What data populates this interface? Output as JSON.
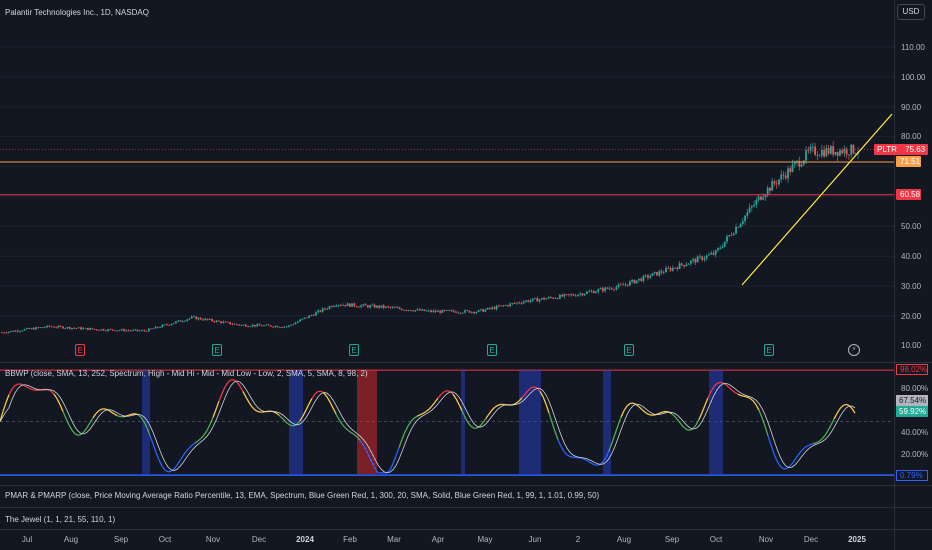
{
  "header": {
    "symbol_title": "Palantir Technologies Inc., 1D, NASDAQ",
    "currency_button": "USD"
  },
  "price_axis": {
    "labels": [
      "110.00",
      "100.00",
      "90.00",
      "80.00",
      "50.00",
      "40.00",
      "30.00",
      "20.00",
      "10.00"
    ],
    "current_price_tag": {
      "symbol": "PLTR",
      "value": "75.63",
      "color": "#f23645"
    },
    "hline_tags": [
      {
        "value": "71.51",
        "color": "#f7a04b"
      },
      {
        "value": "60.58",
        "color": "#f23645"
      }
    ]
  },
  "price_lines": {
    "orange_level": 71.51,
    "red_level": 60.58,
    "current_price": 75.63
  },
  "events": [
    {
      "icon": "earnings-icon",
      "label": "E",
      "color": "#f23645"
    },
    {
      "icon": "earnings-icon",
      "label": "E",
      "color": "#22ab94"
    },
    {
      "icon": "earnings-icon",
      "label": "E",
      "color": "#22ab94"
    },
    {
      "icon": "earnings-icon",
      "label": "E",
      "color": "#22ab94"
    },
    {
      "icon": "earnings-icon",
      "label": "E",
      "color": "#22ab94"
    },
    {
      "icon": "earnings-icon",
      "label": "E",
      "color": "#22ab94"
    },
    {
      "icon": "flash-icon",
      "label": "⚡",
      "color": "#b2b5be"
    }
  ],
  "indicators": {
    "bbwp": {
      "legend": "BBWP (close, SMA, 13, 252, Spectrum, High - Mid Hi - Mid - Mid Low - Low, 2, SMA, 5, SMA, 8, 98, 2)",
      "axis_labels": [
        "80.00%",
        "40.00%",
        "20.00%"
      ],
      "tags": [
        {
          "value": "98.02%",
          "bg": "#131722",
          "fg": "#f23645",
          "border": "#f23645"
        },
        {
          "value": "67.54%",
          "bg": "#b2b5be",
          "fg": "#131722",
          "border": "#b2b5be"
        },
        {
          "value": "59.92%",
          "bg": "#22ab94",
          "fg": "#ffffff",
          "border": "#22ab94"
        },
        {
          "value": "0.79%",
          "bg": "#131722",
          "fg": "#2962ff",
          "border": "#2962ff"
        }
      ]
    },
    "pmarp": {
      "legend": "PMAR & PMARP (close, Price Moving Average Ratio Percentile, 13, EMA, Spectrum, Blue Green Red, 1, 300, 20, SMA, Solid, Blue Green Red, 1, 99, 1, 1.01, 0.99, 50)"
    },
    "jewel": {
      "legend": "The Jewel (1, 1, 21, 55, 110, 1)"
    }
  },
  "time_axis": {
    "labels": [
      "Jul",
      "Aug",
      "Sep",
      "Oct",
      "Nov",
      "Dec",
      "2024",
      "Feb",
      "Mar",
      "Apr",
      "May",
      "Jun",
      "2",
      "Aug",
      "Sep",
      "Oct",
      "Nov",
      "Dec",
      "2025"
    ],
    "bold_labels": [
      "2024",
      "2025"
    ]
  },
  "chart_data": {
    "type": "candlestick",
    "title": "Palantir Technologies Inc., 1D, NASDAQ",
    "currency": "USD",
    "y_range": [
      5,
      118
    ],
    "approx_close_path": [
      {
        "date": "2023-07",
        "close": 14.5
      },
      {
        "date": "2023-08",
        "close": 16.5
      },
      {
        "date": "2023-09",
        "close": 15.5
      },
      {
        "date": "2023-10",
        "close": 15.0
      },
      {
        "date": "2023-11",
        "close": 19.5
      },
      {
        "date": "2023-12",
        "close": 17.0
      },
      {
        "date": "2024-01",
        "close": 16.5
      },
      {
        "date": "2024-02",
        "close": 24.0
      },
      {
        "date": "2024-03",
        "close": 23.0
      },
      {
        "date": "2024-04",
        "close": 21.5
      },
      {
        "date": "2024-05",
        "close": 21.5
      },
      {
        "date": "2024-06",
        "close": 25.0
      },
      {
        "date": "2024-07",
        "close": 27.0
      },
      {
        "date": "2024-08",
        "close": 30.0
      },
      {
        "date": "2024-09",
        "close": 35.5
      },
      {
        "date": "2024-10",
        "close": 41.0
      },
      {
        "date": "2024-11",
        "close": 61.0
      },
      {
        "date": "2024-12",
        "close": 75.0
      },
      {
        "date": "2025-01",
        "close": 75.63
      }
    ],
    "horizontal_levels": [
      71.51,
      60.58
    ],
    "grid": true
  }
}
